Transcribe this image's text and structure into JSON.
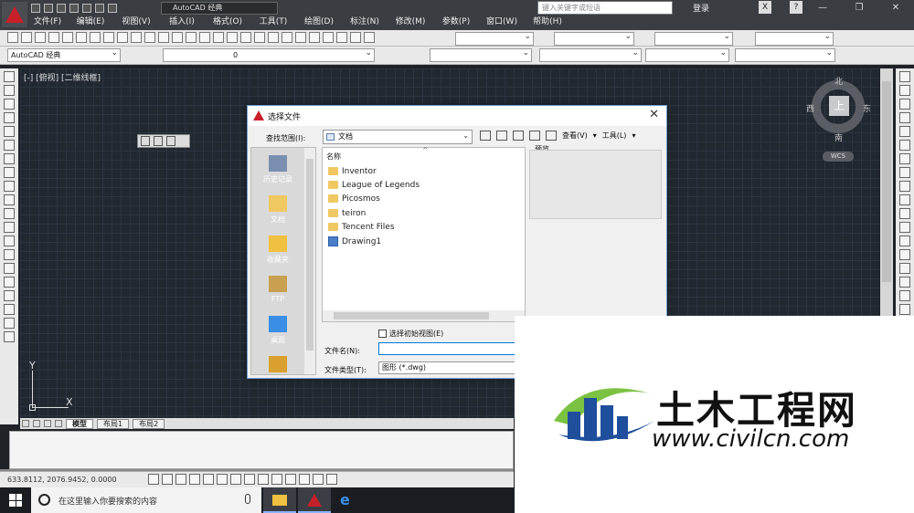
{
  "titlebar": {
    "workspace": "AutoCAD 经典",
    "window_title": "",
    "search_placeholder": "键入关键字或短语",
    "login": "登录"
  },
  "menu": [
    "文件(F)",
    "编辑(E)",
    "视图(V)",
    "插入(I)",
    "格式(O)",
    "工具(T)",
    "绘图(D)",
    "标注(N)",
    "修改(M)",
    "参数(P)",
    "窗口(W)",
    "帮助(H)"
  ],
  "toolbar2": {
    "workspace_combo": "AutoCAD 经典",
    "layer_combo": "0"
  },
  "view_label": "[-] [俯视] [二维线框]",
  "viewcube": {
    "top": "上",
    "north": "北",
    "south": "南",
    "west": "西",
    "east": "东",
    "wcs": "WCS"
  },
  "ucs": {
    "x": "X",
    "y": "Y"
  },
  "layout_tabs": [
    "模型",
    "布局1",
    "布局2"
  ],
  "status": {
    "coords": "633.8112,  2076.9452,  0.0000"
  },
  "taskbar": {
    "search_text": "在这里输入你要搜索的内容"
  },
  "dialog": {
    "title": "选择文件",
    "lookin_label": "查找范围(I):",
    "lookin_value": "文档",
    "view_label": "查看(V)",
    "tools_label": "工具(L)",
    "places": [
      "历史记录",
      "文档",
      "收藏夹",
      "FTP",
      "桌面"
    ],
    "list_header": "名称",
    "files": [
      {
        "name": "Inventor",
        "type": "folder"
      },
      {
        "name": "League of Legends",
        "type": "folder"
      },
      {
        "name": "Picosmos",
        "type": "folder"
      },
      {
        "name": "teiron",
        "type": "folder"
      },
      {
        "name": "Tencent Files",
        "type": "folder"
      },
      {
        "name": "Drawing1",
        "type": "dwg"
      }
    ],
    "preview_label": "预览",
    "initial_view": "选择初始视图(E)",
    "filename_label": "文件名(N):",
    "filename_value": "",
    "filetype_label": "文件类型(T):",
    "filetype_value": "图形 (*.dwg)"
  },
  "watermark": {
    "text": "土木工程网",
    "url": "www.civilcn.com"
  }
}
